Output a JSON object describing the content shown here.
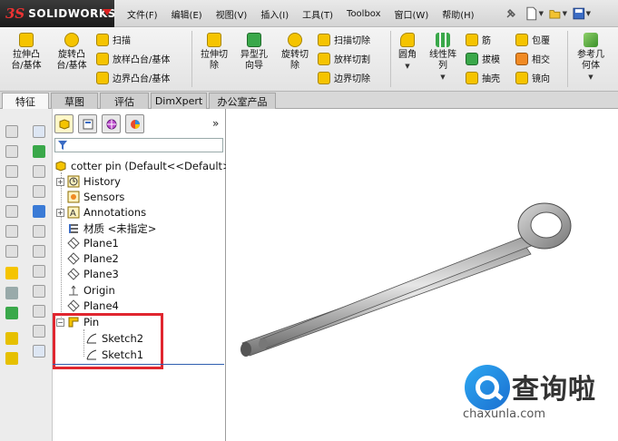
{
  "app": {
    "logo_prefix": "3S",
    "logo_name": "SOLIDWORKS"
  },
  "menu": {
    "items": [
      "文件(F)",
      "编辑(E)",
      "视图(V)",
      "插入(I)",
      "工具(T)",
      "Toolbox",
      "窗口(W)",
      "帮助(H)"
    ]
  },
  "ribbon": {
    "extrude_boss": "拉伸凸\n台/基体",
    "revolve_boss": "旋转凸\n台/基体",
    "sweep": "扫描",
    "loft_boss": "放样凸台/基体",
    "boundary_boss": "边界凸台/基体",
    "extrude_cut": "拉伸切\n除",
    "hole_wizard": "异型孔\n向导",
    "revolve_cut": "旋转切\n除",
    "swept_cut": "扫描切除",
    "lofted_cut": "放样切割",
    "boundary_cut": "边界切除",
    "fillet": "圆角",
    "linear_pattern": "线性阵\n列",
    "rib": "筋",
    "draft": "拔模",
    "shell": "抽壳",
    "wrap": "包覆",
    "intersect": "相交",
    "mirror": "镜向",
    "reference_geometry": "参考几\n何体"
  },
  "tabs": [
    {
      "label": "特征",
      "active": true
    },
    {
      "label": "草图",
      "active": false
    },
    {
      "label": "评估",
      "active": false
    },
    {
      "label": "DimXpert",
      "active": false
    },
    {
      "label": "办公室产品",
      "active": false
    }
  ],
  "feature_tree": {
    "root": "cotter pin  (Default<<Default>",
    "items": [
      {
        "label": "History",
        "icon": "history-icon",
        "expandable": true
      },
      {
        "label": "Sensors",
        "icon": "sensors-icon",
        "expandable": false
      },
      {
        "label": "Annotations",
        "icon": "annotations-icon",
        "expandable": true
      },
      {
        "label": "材质 <未指定>",
        "icon": "material-icon",
        "expandable": false
      },
      {
        "label": "Plane1",
        "icon": "plane-icon",
        "expandable": false
      },
      {
        "label": "Plane2",
        "icon": "plane-icon",
        "expandable": false
      },
      {
        "label": "Plane3",
        "icon": "plane-icon",
        "expandable": false
      },
      {
        "label": "Origin",
        "icon": "origin-icon",
        "expandable": false
      },
      {
        "label": "Plane4",
        "icon": "plane-icon",
        "expandable": false
      }
    ],
    "pin": {
      "label": "Pin",
      "children": [
        "Sketch2",
        "Sketch1"
      ]
    },
    "more_symbol": "»"
  },
  "watermark": {
    "brand": "查询啦",
    "url": "chaxunla.com"
  },
  "colors": {
    "highlight_box": "#e0262f",
    "brand_red": "#d22222",
    "feature_yellow": "#f5c400"
  }
}
